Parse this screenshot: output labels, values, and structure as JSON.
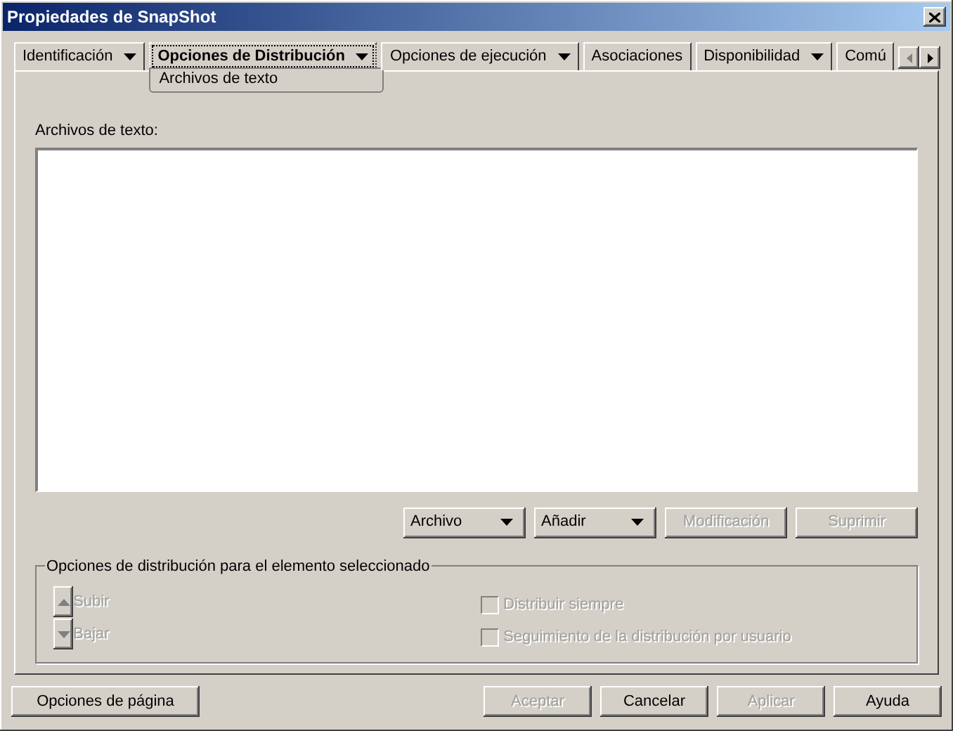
{
  "window": {
    "title": "Propiedades de SnapShot"
  },
  "tabs": [
    {
      "label": "Identificación",
      "dropdown": true,
      "selected": false
    },
    {
      "label": "Opciones de Distribución",
      "dropdown": true,
      "selected": true,
      "subitems": [
        "Archivos de texto"
      ]
    },
    {
      "label": "Opciones de ejecución",
      "dropdown": true,
      "selected": false
    },
    {
      "label": "Asociaciones",
      "dropdown": false,
      "selected": false
    },
    {
      "label": "Disponibilidad",
      "dropdown": true,
      "selected": false
    },
    {
      "label": "Comú",
      "dropdown": false,
      "selected": false
    }
  ],
  "list": {
    "label": "Archivos de texto:"
  },
  "list_buttons": [
    {
      "label": "Archivo",
      "kind": "menu",
      "disabled": false
    },
    {
      "label": "Añadir",
      "kind": "menu",
      "disabled": false
    },
    {
      "label": "Modificación",
      "kind": "push",
      "disabled": true
    },
    {
      "label": "Suprimir",
      "kind": "push",
      "disabled": true
    }
  ],
  "group": {
    "title": "Opciones de distribución para el elemento seleccionado",
    "moves": [
      {
        "label": "Subir",
        "kind": "up",
        "disabled": true
      },
      {
        "label": "Bajar",
        "kind": "down",
        "disabled": true
      }
    ],
    "checkboxes": [
      {
        "label": "Distribuir siempre",
        "checked": false,
        "disabled": true
      },
      {
        "label": "Seguimiento de la distribución por usuario",
        "checked": false,
        "disabled": true
      }
    ]
  },
  "page_options": {
    "label": "Opciones de página"
  },
  "footer_buttons": [
    {
      "label": "Aceptar",
      "disabled": true
    },
    {
      "label": "Cancelar",
      "disabled": false
    },
    {
      "label": "Aplicar",
      "disabled": true
    },
    {
      "label": "Ayuda",
      "disabled": false
    }
  ]
}
